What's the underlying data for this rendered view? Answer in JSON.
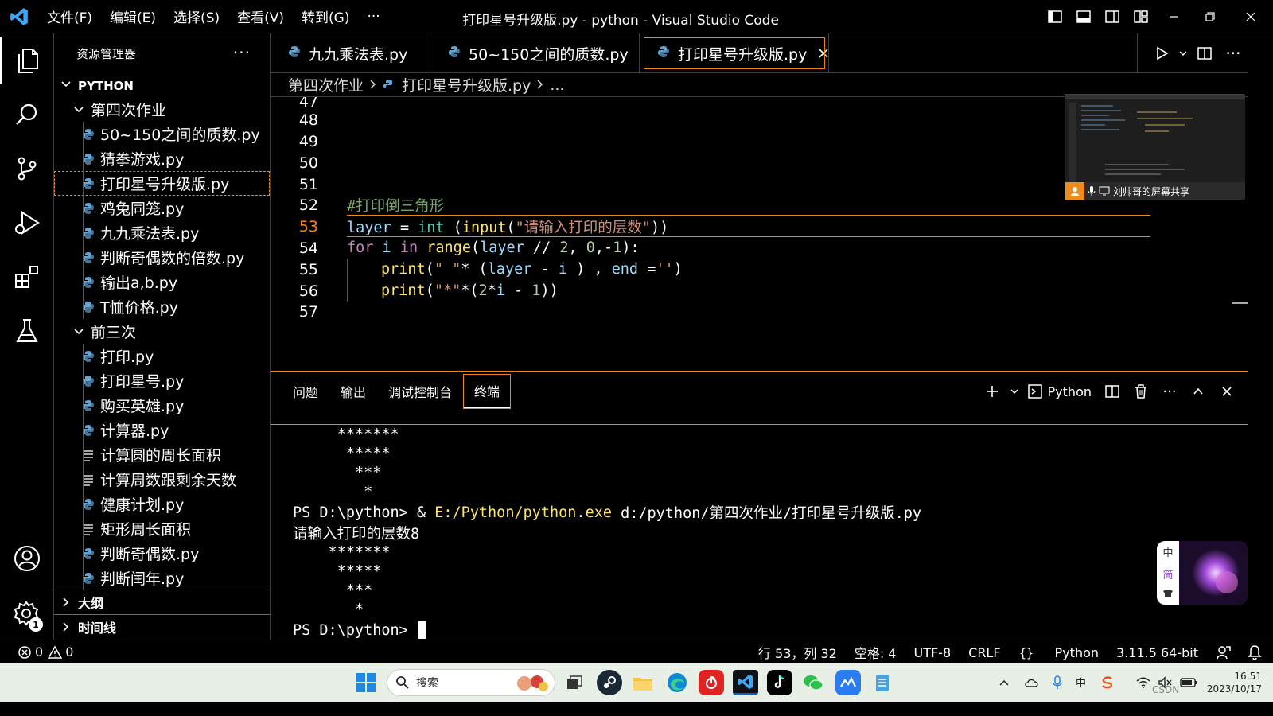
{
  "window": {
    "title": "打印星号升级版.py - python - Visual Studio Code",
    "menu": [
      "文件(F)",
      "编辑(E)",
      "选择(S)",
      "查看(V)",
      "转到(G)",
      "···"
    ]
  },
  "sidebar": {
    "header": "资源管理器",
    "more": "···",
    "root": "PYTHON",
    "folder1": "第四次作业",
    "folder1_items": [
      "50~150之间的质数.py",
      "猜拳游戏.py",
      "打印星号升级版.py",
      "鸡兔同笼.py",
      "九九乘法表.py",
      "判断奇偶数的倍数.py",
      "输出a,b.py",
      "T恤价格.py"
    ],
    "folder2": "前三次",
    "folder2_items": [
      {
        "name": "打印.py",
        "type": "py"
      },
      {
        "name": "打印星号.py",
        "type": "py"
      },
      {
        "name": "购买英雄.py",
        "type": "py"
      },
      {
        "name": "计算器.py",
        "type": "py"
      },
      {
        "name": "计算圆的周长面积",
        "type": "txt"
      },
      {
        "name": "计算周数跟剩余天数",
        "type": "txt"
      },
      {
        "name": "健康计划.py",
        "type": "py"
      },
      {
        "name": "矩形周长面积",
        "type": "txt"
      },
      {
        "name": "判断奇偶数.py",
        "type": "py"
      },
      {
        "name": "判断闰年.py",
        "type": "py"
      }
    ],
    "outline": "大纲",
    "timeline": "时间线"
  },
  "tabs": [
    {
      "label": "九九乘法表.py",
      "active": false
    },
    {
      "label": "50~150之间的质数.py",
      "active": false
    },
    {
      "label": "打印星号升级版.py",
      "active": true
    }
  ],
  "breadcrumb": {
    "folder": "第四次作业",
    "file": "打印星号升级版.py",
    "tail": "..."
  },
  "editor": {
    "line_numbers": [
      "47",
      "48",
      "49",
      "50",
      "51",
      "52",
      "53",
      "54",
      "55",
      "56",
      "57"
    ],
    "current_line": "53",
    "code": {
      "l52": "#打印倒三角形",
      "l53_var": "layer",
      "l53_eq": " = ",
      "l53_int": "int",
      "l53_open": " (",
      "l53_input": "input",
      "l53_p": "(",
      "l53_str": "\"请输入打印的层数\"",
      "l53_close": "))",
      "l54_for": "for",
      "l54_i": " i ",
      "l54_in": "in",
      "l54_range": " range",
      "l54_args_a": "(",
      "l54_layer": "layer",
      "l54_args_b": " // ",
      "l54_2": "2",
      "l54_c": ", ",
      "l54_0": "0",
      "l54_d": ",-",
      "l54_1": "1",
      "l54_e": "):",
      "l55_print": "print",
      "l55_a": "(",
      "l55_s1": "\" \"",
      "l55_star": "* ",
      "l55_b": "(",
      "l55_layer": "layer",
      "l55_c": " - ",
      "l55_i": "i",
      "l55_d": " ) ",
      "l55_e": ", ",
      "l55_end": "end",
      "l55_f": " =",
      "l55_s2": "''",
      "l55_g": ")",
      "l56_print": "print",
      "l56_a": "(",
      "l56_s": "\"*\"",
      "l56_b": "*(",
      "l56_2": "2",
      "l56_c": "*",
      "l56_i": "i",
      "l56_d": " - ",
      "l56_1": "1",
      "l56_e": "))"
    }
  },
  "share_overlay": {
    "label": "刘帅哥的屏幕共享"
  },
  "panel": {
    "tabs": [
      "问题",
      "输出",
      "调试控制台",
      "终端"
    ],
    "active_tab": "终端",
    "terminal_name": "Python",
    "lines": [
      "     *******",
      "      *****",
      "       ***",
      "        *",
      "",
      "",
      "请输入打印的层数8",
      "    *******",
      "     *****",
      "      ***",
      "       *",
      ""
    ],
    "cmd_prompt": "PS D:\\python> ",
    "cmd_amp": "& ",
    "cmd_exe": "E:/Python/python.exe",
    "cmd_arg": " d:/python/第四次作业/打印星号升级版.py",
    "final_prompt": "PS D:\\python> "
  },
  "status": {
    "errors": "0",
    "warnings": "0",
    "position": "行 53，列 32",
    "spaces": "空格: 4",
    "encoding": "UTF-8",
    "eol": "CRLF",
    "language": "Python",
    "interpreter": "3.11.5 64-bit"
  },
  "taskbar": {
    "search_placeholder": "搜索",
    "time": "16:51",
    "date": "2023/10/17",
    "watermark": "CSDN"
  },
  "widget": {
    "chars": [
      "中",
      "简"
    ]
  },
  "colors": {
    "accent": "#f38518",
    "keyword": "#c586c0",
    "function": "#ffe567",
    "string": "#ce9178",
    "number": "#b5cea8",
    "variable": "#9cdcfe",
    "comment": "#7ca668"
  }
}
